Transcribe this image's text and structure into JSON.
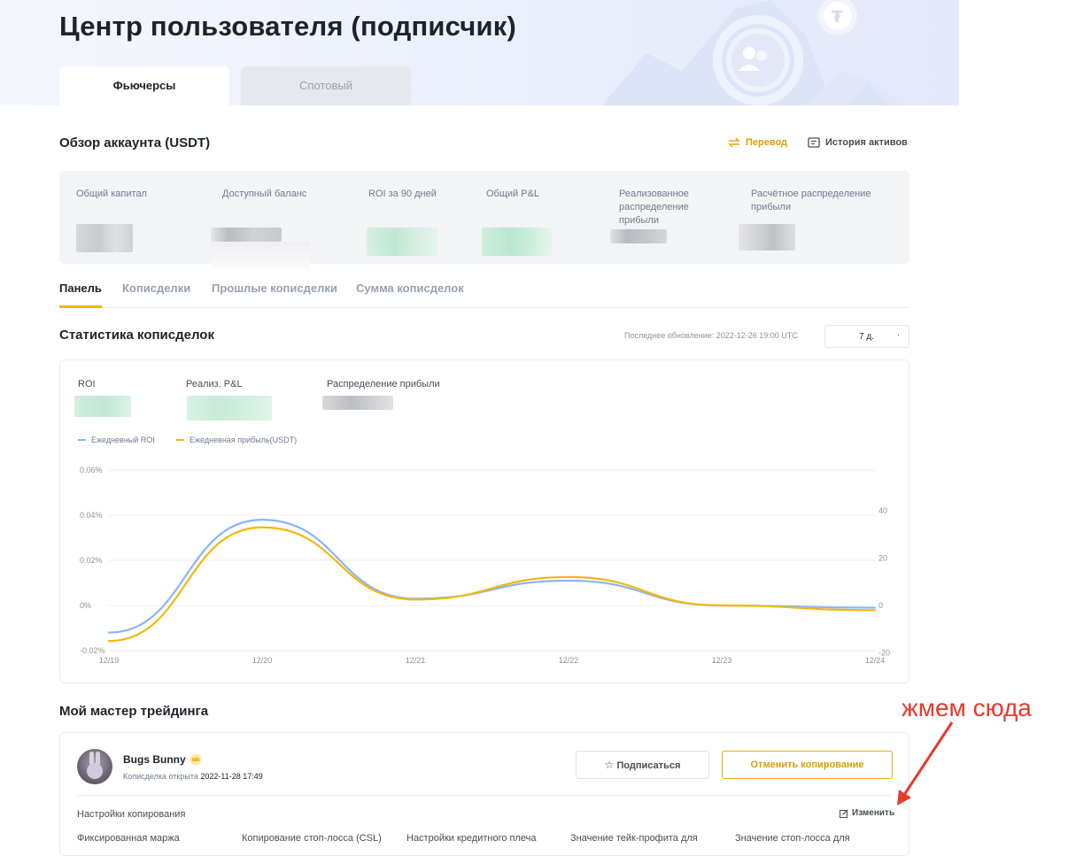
{
  "header": {
    "title": "Центр пользователя (подписчик)",
    "tabs": [
      {
        "label": "Фьючерсы",
        "active": true
      },
      {
        "label": "Спотовый",
        "active": false
      }
    ]
  },
  "overview": {
    "title": "Обзор аккаунта (USDT)",
    "actions": {
      "transfer_label": "Перевод",
      "history_label": "История активов"
    },
    "columns": [
      {
        "label": "Общий капитал"
      },
      {
        "label": "Доступный баланс"
      },
      {
        "label": "ROI за 90 дней"
      },
      {
        "label": "Общий P&L"
      },
      {
        "label": "Реализованное распределение прибыли"
      },
      {
        "label": "Расчётное распределение прибыли"
      }
    ]
  },
  "subtabs": [
    {
      "label": "Панель",
      "active": true
    },
    {
      "label": "Копиcделки",
      "active": false
    },
    {
      "label": "Прошлые копиcделки",
      "active": false
    },
    {
      "label": "Сумма копиcделок",
      "active": false
    }
  ],
  "stats": {
    "title": "Статистика копиcделок",
    "updated": "Последнее обновление: 2022-12-26 19:00 UTC",
    "period_selected": "7 д.",
    "labels": {
      "roi": "ROI",
      "pnl": "Реализ. P&L",
      "profit_share": "Распределение прибыли"
    }
  },
  "chart_data": {
    "type": "line",
    "x": [
      "12/19",
      "12/20",
      "12/21",
      "12/22",
      "12/23",
      "12/24"
    ],
    "series": [
      {
        "name": "Ежедневный ROI",
        "color": "#8ab4f8",
        "axis": "left",
        "values": [
          -0.012,
          0.038,
          0.003,
          0.011,
          0.0,
          -0.001
        ]
      },
      {
        "name": "Ежедневная прибыль(USDT)",
        "color": "#f0b90b",
        "axis": "right",
        "values": [
          -15,
          33,
          2.5,
          12,
          0,
          -2
        ]
      }
    ],
    "left_ticks": [
      "0.06%",
      "0.04%",
      "0.02%",
      "0%",
      "-0.02%"
    ],
    "right_ticks": [
      "40",
      "20",
      "0",
      "-20"
    ],
    "ylim_left": [
      -0.02,
      0.06
    ],
    "ylim_right": [
      -20,
      40
    ],
    "grid": true,
    "legend": "top-left"
  },
  "master": {
    "title": "Мой мастер трейдинга",
    "name": "Bugs Bunny",
    "opened_label": "Копиcделка открыта",
    "opened_date": "2022-11-28 17:49",
    "subscribe_label": "Подписаться",
    "cancel_label": "Отменить копирование",
    "settings_title": "Настройки копирования",
    "edit_label": "Изменить",
    "settings_columns": [
      "Фиксированная маржа",
      "Копирование стоп-лосса (CSL)",
      "Настройки кредитного плеча",
      "Значение тейк-профита для",
      "Значение стоп-лосса для"
    ]
  },
  "annotation": {
    "text": "жмем сюда",
    "color": "#e53a2e"
  }
}
